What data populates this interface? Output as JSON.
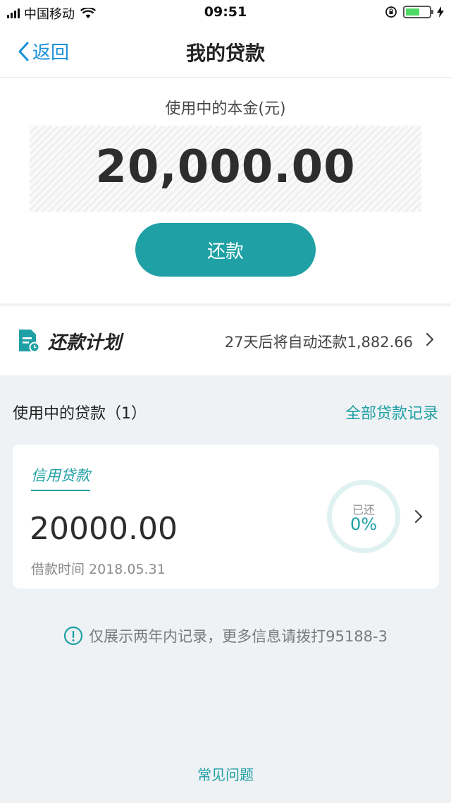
{
  "status_bar": {
    "carrier": "中国移动",
    "time": "09:51",
    "battery_level": 0.6
  },
  "nav": {
    "back_label": "返回",
    "title": "我的贷款"
  },
  "principal": {
    "label": "使用中的本金(元)",
    "amount": "20,000.00",
    "repay_button": "还款"
  },
  "plan": {
    "title": "还款计划",
    "info": "27天后将自动还款1,882.66"
  },
  "loans": {
    "section_title": "使用中的贷款（1）",
    "all_records_link": "全部贷款记录",
    "items": [
      {
        "type": "信用贷款",
        "amount": "20000.00",
        "date": "借款时间 2018.05.31",
        "repaid_label": "已还",
        "repaid_percent": "0%"
      }
    ]
  },
  "notice": "仅展示两年内记录，更多信息请拨打95188-3",
  "footer": {
    "faq_link": "常见问题"
  },
  "colors": {
    "accent": "#1fa0a4",
    "link_blue": "#1a90d9",
    "background": "#eef2f4"
  },
  "icons": [
    "signal-icon",
    "wifi-icon",
    "orientation-lock-icon",
    "battery-icon",
    "charging-icon",
    "back-chevron-icon",
    "repayment-plan-icon",
    "chevron-right-icon",
    "info-icon"
  ]
}
